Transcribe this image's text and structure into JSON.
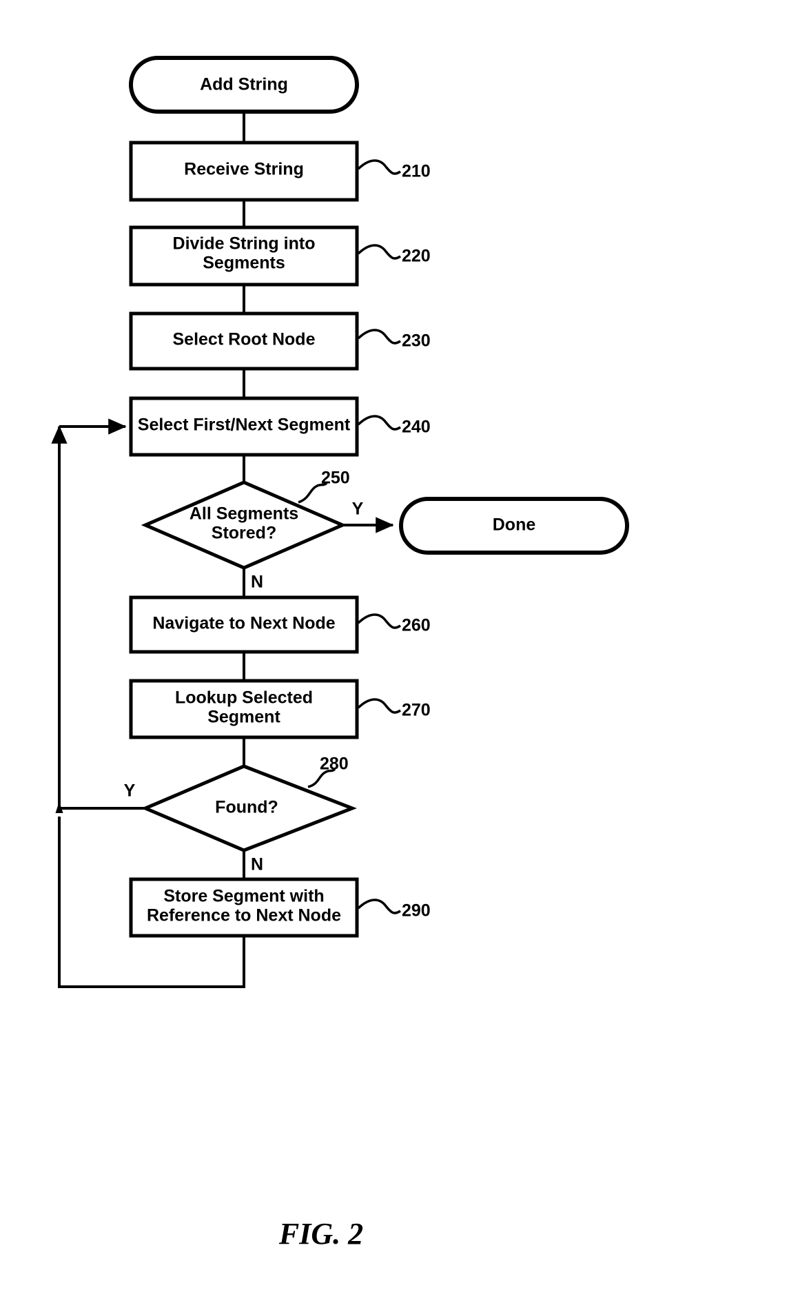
{
  "figure": {
    "caption": "FIG. 2",
    "title": "Add String flowchart"
  },
  "colors": {
    "stroke": "#000000",
    "fill": "#ffffff",
    "background": "#ffffff"
  },
  "nodes": [
    {
      "id": "start",
      "type": "terminator",
      "label": "Add String",
      "ref": ""
    },
    {
      "id": "n210",
      "type": "process",
      "label": "Receive String",
      "ref": "210"
    },
    {
      "id": "n220",
      "type": "process",
      "label_line1": "Divide String into",
      "label_line2": "Segments",
      "ref": "220"
    },
    {
      "id": "n230",
      "type": "process",
      "label": "Select Root Node",
      "ref": "230"
    },
    {
      "id": "n240",
      "type": "process",
      "label": "Select First/Next Segment",
      "ref": "240"
    },
    {
      "id": "n250",
      "type": "decision",
      "label_line1": "All Segments",
      "label_line2": "Stored?",
      "ref": "250"
    },
    {
      "id": "done",
      "type": "terminator",
      "label": "Done",
      "ref": ""
    },
    {
      "id": "n260",
      "type": "process",
      "label": "Navigate to Next Node",
      "ref": "260"
    },
    {
      "id": "n270",
      "type": "process",
      "label_line1": "Lookup Selected",
      "label_line2": "Segment",
      "ref": "270"
    },
    {
      "id": "n280",
      "type": "decision",
      "label": "Found?",
      "ref": "280"
    },
    {
      "id": "n290",
      "type": "process",
      "label_line1": "Store Segment with",
      "label_line2": "Reference to Next Node",
      "ref": "290"
    }
  ],
  "branch_labels": {
    "all_segments_yes": "Y",
    "all_segments_no": "N",
    "found_yes": "Y",
    "found_no": "N"
  },
  "chart_data": {
    "type": "diagram",
    "title": "FIG. 2",
    "nodes": [
      {
        "ref": "",
        "text": "Add String",
        "shape": "terminator"
      },
      {
        "ref": "210",
        "text": "Receive String",
        "shape": "process"
      },
      {
        "ref": "220",
        "text": "Divide String into Segments",
        "shape": "process"
      },
      {
        "ref": "230",
        "text": "Select Root Node",
        "shape": "process"
      },
      {
        "ref": "240",
        "text": "Select First/Next Segment",
        "shape": "process"
      },
      {
        "ref": "250",
        "text": "All Segments Stored?",
        "shape": "decision"
      },
      {
        "ref": "",
        "text": "Done",
        "shape": "terminator"
      },
      {
        "ref": "260",
        "text": "Navigate to Next Node",
        "shape": "process"
      },
      {
        "ref": "270",
        "text": "Lookup Selected Segment",
        "shape": "process"
      },
      {
        "ref": "280",
        "text": "Found?",
        "shape": "decision"
      },
      {
        "ref": "290",
        "text": "Store Segment with Reference to Next Node",
        "shape": "process"
      }
    ],
    "edges": [
      {
        "from": "Add String",
        "to": "Receive String",
        "label": ""
      },
      {
        "from": "Receive String",
        "to": "Divide String into Segments",
        "label": ""
      },
      {
        "from": "Divide String into Segments",
        "to": "Select Root Node",
        "label": ""
      },
      {
        "from": "Select Root Node",
        "to": "Select First/Next Segment",
        "label": ""
      },
      {
        "from": "Select First/Next Segment",
        "to": "All Segments Stored?",
        "label": ""
      },
      {
        "from": "All Segments Stored?",
        "to": "Done",
        "label": "Y"
      },
      {
        "from": "All Segments Stored?",
        "to": "Navigate to Next Node",
        "label": "N"
      },
      {
        "from": "Navigate to Next Node",
        "to": "Lookup Selected Segment",
        "label": ""
      },
      {
        "from": "Lookup Selected Segment",
        "to": "Found?",
        "label": ""
      },
      {
        "from": "Found?",
        "to": "Select First/Next Segment",
        "label": "Y"
      },
      {
        "from": "Found?",
        "to": "Store Segment with Reference to Next Node",
        "label": "N"
      },
      {
        "from": "Store Segment with Reference to Next Node",
        "to": "Select First/Next Segment",
        "label": ""
      }
    ]
  }
}
